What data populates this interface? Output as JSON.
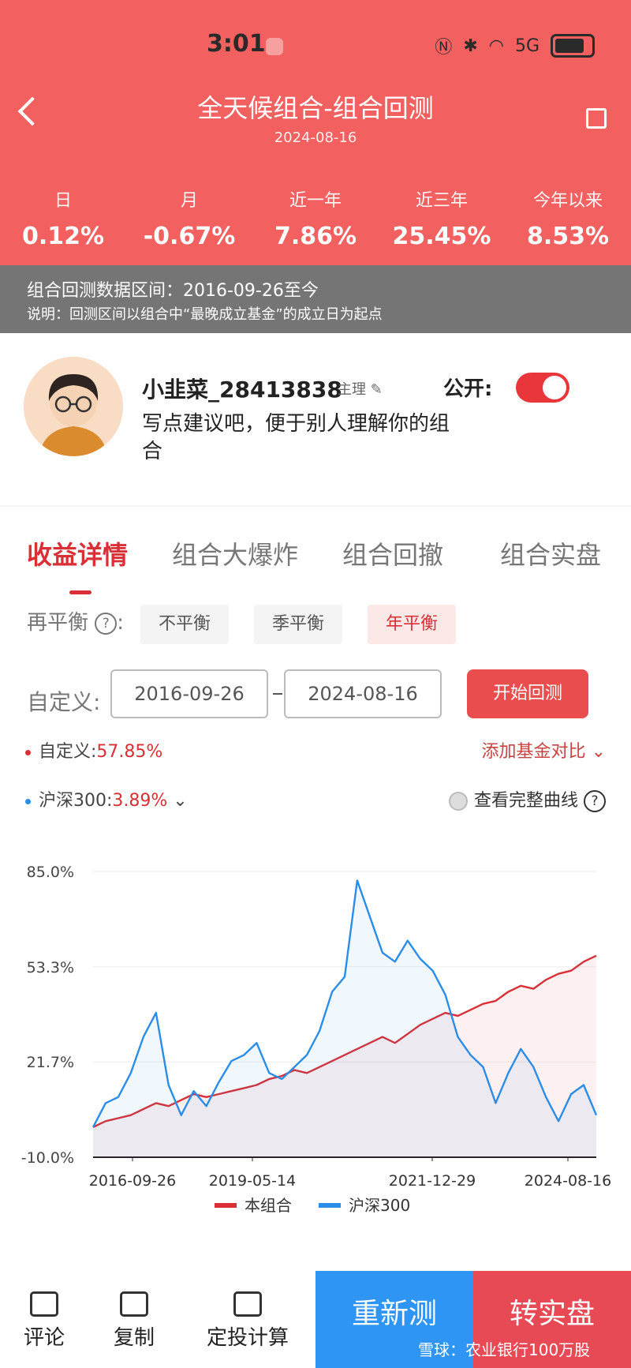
{
  "status_bar": {
    "time": "3:01",
    "network": "5G"
  },
  "header": {
    "title": "全天候组合-组合回测",
    "date": "2024-08-16"
  },
  "stats": [
    {
      "label": "日",
      "value": "0.12%"
    },
    {
      "label": "月",
      "value": "-0.67%"
    },
    {
      "label": "近一年",
      "value": "7.86%"
    },
    {
      "label": "近三年",
      "value": "25.45%"
    },
    {
      "label": "今年以来",
      "value": "8.53%"
    }
  ],
  "range": {
    "line1": "组合回测数据区间：2016-09-26至今",
    "line2": "说明：回测区间以组合中“最晚成立基金”的成立日为起点"
  },
  "profile": {
    "username": "小韭菜_28413838",
    "role": "主理",
    "description": "写点建议吧，便于别人理解你的组合",
    "public_label": "公开:"
  },
  "tabs": [
    "收益详情",
    "组合大爆炸",
    "组合回撤",
    "组合实盘"
  ],
  "rebalance": {
    "label": "再平衡",
    "help": "?",
    "colon": ":",
    "options": [
      "不平衡",
      "季平衡",
      "年平衡"
    ]
  },
  "custom": {
    "label": "自定义:",
    "start": "2016-09-26",
    "end": "2024-08-16",
    "start_button": "开始回测"
  },
  "legend": {
    "custom_name": "自定义:",
    "custom_value": "57.85%",
    "hs300_name": "沪深300:",
    "hs300_value": "3.89%",
    "add_compare": "添加基金对比",
    "full_curve": "查看完整曲线",
    "full_curve_help": "?"
  },
  "chart_data": {
    "type": "line",
    "yticks": [
      "85.0%",
      "53.3%",
      "21.7%",
      "-10.0%"
    ],
    "ylim": [
      -10.0,
      85.0
    ],
    "x_ticks": [
      "2016-09-26",
      "2019-05-14",
      "2021-12-29",
      "2024-08-16"
    ],
    "legend": [
      "本组合",
      "沪深300"
    ],
    "series": [
      {
        "name": "本组合",
        "color": "#d92f36",
        "values": [
          0,
          2,
          3,
          4,
          6,
          8,
          7,
          9,
          11,
          10,
          11,
          12,
          13,
          14,
          16,
          17,
          19,
          18,
          20,
          22,
          24,
          26,
          28,
          30,
          28,
          31,
          34,
          36,
          38,
          37,
          39,
          41,
          42,
          45,
          47,
          46,
          49,
          51,
          52,
          55,
          57
        ]
      },
      {
        "name": "沪深300",
        "color": "#2a8de8",
        "values": [
          0,
          8,
          10,
          18,
          30,
          38,
          14,
          4,
          12,
          7,
          15,
          22,
          24,
          28,
          18,
          16,
          20,
          24,
          32,
          45,
          50,
          82,
          70,
          58,
          55,
          62,
          56,
          52,
          44,
          30,
          24,
          20,
          8,
          18,
          26,
          20,
          10,
          2,
          11,
          14,
          4
        ]
      }
    ]
  },
  "bottom": {
    "comment": "评论",
    "copy": "复制",
    "dca": "定投计算",
    "retest": "重新测",
    "to_real": "转实盘",
    "watermark": "雪球：农业银行100万股"
  }
}
